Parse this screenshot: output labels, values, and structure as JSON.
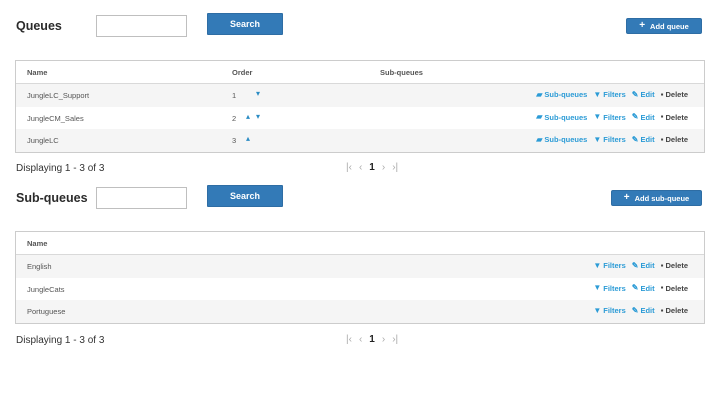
{
  "queues": {
    "title": "Queues",
    "search_placeholder": "",
    "search_label": "Search",
    "add_label": "Add queue",
    "columns": {
      "name": "Name",
      "order": "Order",
      "subqueues": "Sub-queues"
    },
    "rows": [
      {
        "name": "JungleLC_Support",
        "order": "1"
      },
      {
        "name": "JungleCM_Sales",
        "order": "2"
      },
      {
        "name": "JungleLC",
        "order": "3"
      }
    ],
    "actions": {
      "subqueues": "Sub-queues",
      "filters": "Filters",
      "edit": "Edit",
      "delete": "Delete"
    },
    "displaying": "Displaying 1 - 3 of 3",
    "pagination": {
      "current": "1"
    }
  },
  "subqueues": {
    "title": "Sub-queues",
    "search_placeholder": "",
    "search_label": "Search",
    "add_label": "Add sub-queue",
    "columns": {
      "name": "Name"
    },
    "rows": [
      {
        "name": "English"
      },
      {
        "name": "JungleCats"
      },
      {
        "name": "Portuguese"
      }
    ],
    "actions": {
      "filters": "Filters",
      "edit": "Edit",
      "delete": "Delete"
    },
    "displaying": "Displaying 1 - 3 of 3",
    "pagination": {
      "current": "1"
    }
  },
  "icons": {
    "plus": "plus-icon",
    "briefcase": "briefcase-icon",
    "filter": "filter-icon",
    "pencil": "pencil-icon",
    "trash": "trash-icon",
    "arrow_up": "arrow-up-icon",
    "arrow_down": "arrow-down-icon",
    "first": "first-page-icon",
    "prev": "prev-page-icon",
    "next": "next-page-icon",
    "last": "last-page-icon"
  },
  "colors": {
    "primary": "#337ab7",
    "link": "#2b9bd6",
    "row_alt": "#f5f5f5"
  }
}
